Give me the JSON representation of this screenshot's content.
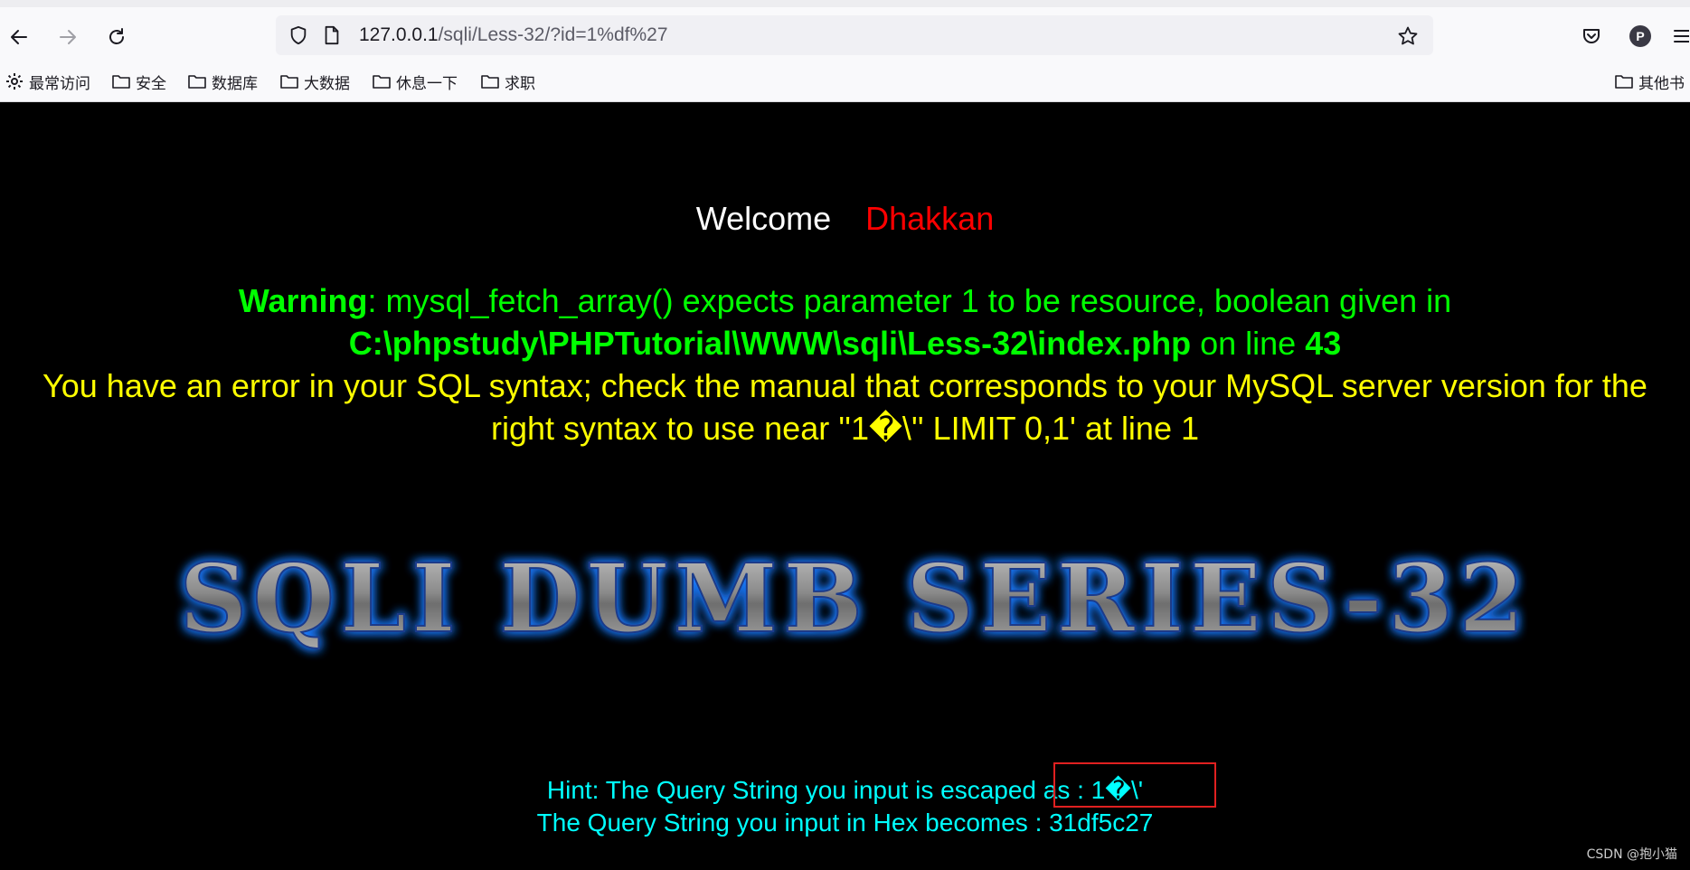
{
  "browser": {
    "url_host": "127.0.0.1",
    "url_path": "/sqli/Less-32/?id=1%df%27",
    "profile_letter": "P",
    "bookmarks": [
      "最常访问",
      "安全",
      "数据库",
      "大数据",
      "休息一下",
      "求职"
    ],
    "other_bookmarks": "其他书"
  },
  "page": {
    "welcome": "Welcome",
    "user": "Dhakkan",
    "warning_label": "Warning",
    "warning_text": ": mysql_fetch_array() expects parameter 1 to be resource, boolean given in ",
    "warning_path": "C:\\phpstudy\\PHPTutorial\\WWW\\sqli\\Less-32\\index.php",
    "warning_online": " on line ",
    "warning_line": "43",
    "sql_error": "You have an error in your SQL syntax; check the manual that corresponds to your MySQL server version for the right syntax to use near ''1�\\'' LIMIT 0,1' at line 1",
    "banner": "SQLI DUMB SERIES-32",
    "hint_line1": "Hint: The Query String you input is escaped as : 1�\\'",
    "hint_line2": "The Query String you input in Hex becomes : 31df5c27",
    "watermark": "CSDN @抱小猫"
  },
  "colors": {
    "welcome": "#ffffff",
    "user": "#ff0000",
    "warning": "#00ff00",
    "sql_error": "#ffff00",
    "hint": "#00ffff",
    "highlight": "#e02020"
  }
}
